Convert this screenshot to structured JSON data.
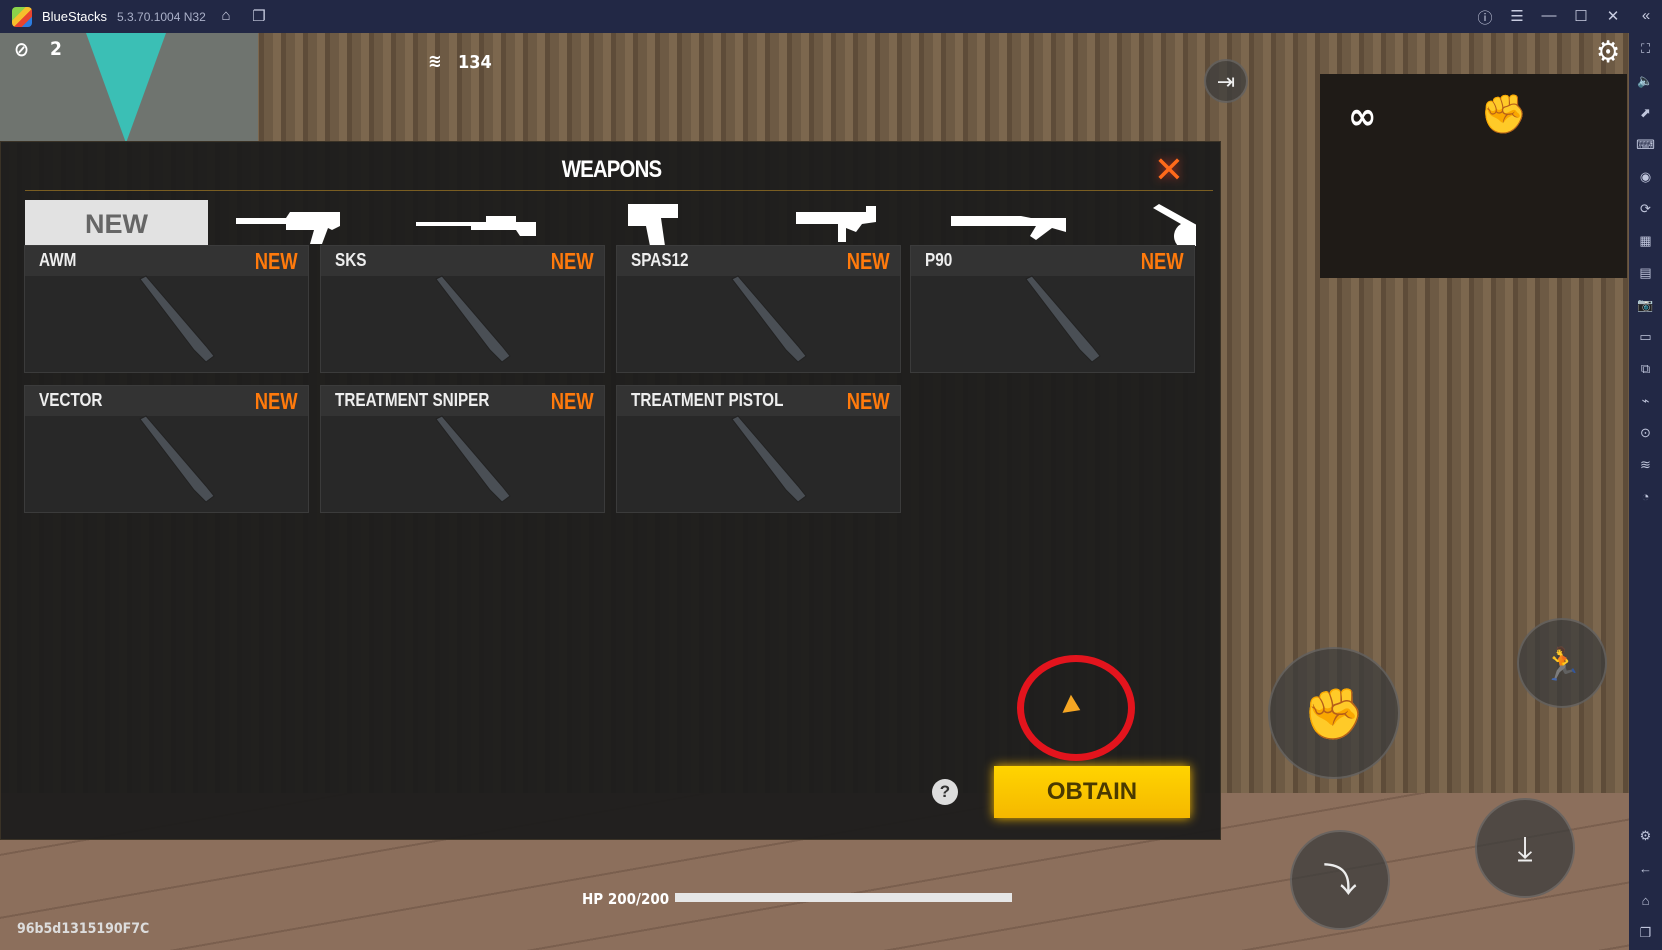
{
  "titlebar": {
    "app_name": "BlueStacks",
    "version": "5.3.70.1004 N32"
  },
  "hud": {
    "kill_count": "2",
    "ping": "134",
    "hp_label": "HP 200/200",
    "hp_fraction": 1.0,
    "player_id": "96b5d1315190F7C"
  },
  "panel": {
    "title": "WEAPONS",
    "tabs": [
      {
        "label": "NEW",
        "active": true
      },
      {
        "icon": "assault-rifle-icon"
      },
      {
        "icon": "sniper-rifle-icon"
      },
      {
        "icon": "pistol-icon"
      },
      {
        "icon": "smg-icon"
      },
      {
        "icon": "shotgun-icon"
      },
      {
        "icon": "pan-icon"
      }
    ],
    "weapons": [
      {
        "name": "AWM",
        "badge": "NEW"
      },
      {
        "name": "SKS",
        "badge": "NEW"
      },
      {
        "name": "SPAS12",
        "badge": "NEW"
      },
      {
        "name": "P90",
        "badge": "NEW"
      },
      {
        "name": "VECTOR",
        "badge": "NEW"
      },
      {
        "name": "TREATMENT SNIPER",
        "badge": "NEW"
      },
      {
        "name": "TREATMENT PISTOL",
        "badge": "NEW"
      }
    ],
    "obtain_label": "OBTAIN",
    "help_label": "?"
  },
  "colors": {
    "accent_orange": "#ff7a0c",
    "obtain_yellow": "#ffd400",
    "highlight_red": "#e3141d",
    "titlebar": "#222845"
  }
}
